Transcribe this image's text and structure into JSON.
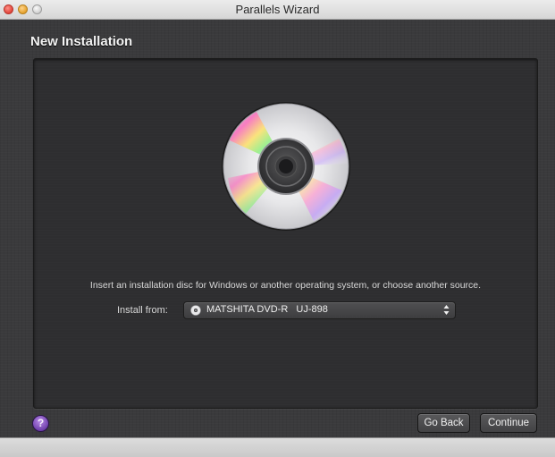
{
  "window": {
    "title": "Parallels Wizard"
  },
  "page": {
    "heading": "New Installation",
    "instructions": "Insert an installation disc for Windows or another operating system, or choose another source.",
    "install_from_label": "Install from:",
    "install_from_value": "MATSHITA DVD-R   UJ-898"
  },
  "footer": {
    "help_label": "?",
    "back_label": "Go Back",
    "continue_label": "Continue"
  },
  "icons": {
    "close": "close-icon",
    "minimize": "minimize-icon",
    "zoom": "zoom-icon",
    "disc": "cd-disc-icon",
    "drive": "optical-drive-icon",
    "select_arrows": "updown-arrows-icon",
    "help": "help-icon"
  },
  "colors": {
    "window_bg": "#3a3a3c",
    "panel_bg": "#2e2e30",
    "help_accent": "#6a3aa8"
  }
}
